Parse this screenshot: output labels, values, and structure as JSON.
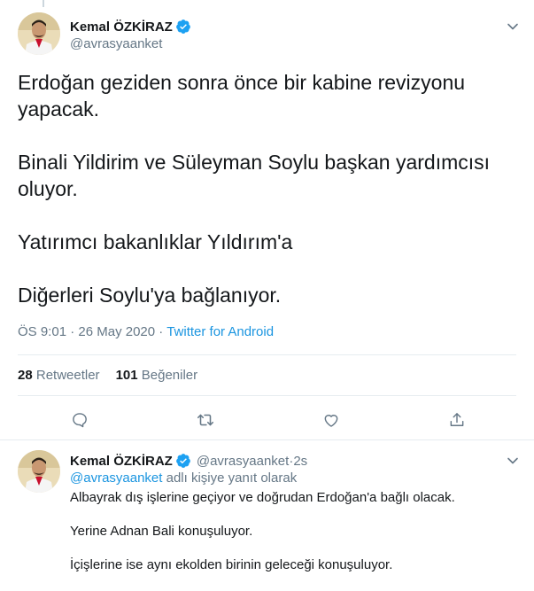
{
  "colors": {
    "accent": "#1b95e0",
    "secondary_text": "#657786",
    "primary_text": "#14171a",
    "verified": "#1da1f2",
    "border": "#e6ecf0"
  },
  "main_tweet": {
    "author": {
      "display_name": "Kemal ÖZKİRAZ",
      "handle": "@avrasyaanket",
      "verified_icon": "verified-badge-icon"
    },
    "caret_icon": "chevron-down-icon",
    "paragraphs": [
      "Erdoğan geziden sonra önce bir kabine revizyonu yapacak.",
      "Binali Yildirim ve Süleyman Soylu başkan yardımcısı oluyor.",
      "Yatırımcı bakanlıklar Yıldırım'a",
      "Diğerleri Soylu'ya bağlanıyor."
    ],
    "meta": {
      "time": "ÖS 9:01",
      "separator1": " · ",
      "date": "26 May 2020",
      "separator2": " · ",
      "source": "Twitter for Android"
    },
    "stats": {
      "retweets_count": "28",
      "retweets_label": "Retweetler",
      "likes_count": "101",
      "likes_label": "Beğeniler"
    },
    "actions": [
      "reply-icon",
      "retweet-icon",
      "like-icon",
      "share-icon"
    ]
  },
  "reply_tweet": {
    "author": {
      "display_name": "Kemal ÖZKİRAZ",
      "handle": "@avrasyaanket",
      "separator": " · ",
      "time": "2s"
    },
    "replying_to": {
      "mention": "@avrasyaanket",
      "suffix": " adlı kişiye yanıt olarak"
    },
    "paragraphs": [
      "Albayrak dış işlerine geçiyor ve doğrudan Erdoğan'a bağlı olacak.",
      "Yerine Adnan Bali konuşuluyor.",
      "İçişlerine ise aynı ekolden birinin geleceği konuşuluyor."
    ]
  }
}
